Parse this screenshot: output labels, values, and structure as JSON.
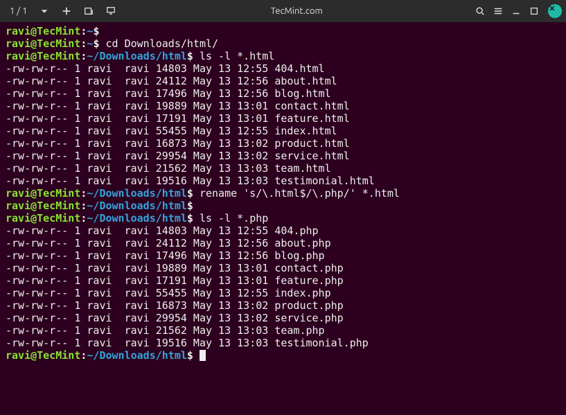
{
  "titlebar": {
    "tab_counter": "1 / 1",
    "title": "TecMint.com"
  },
  "prompts": [
    {
      "user": "ravi",
      "host": "TecMint",
      "path": "~",
      "command": ""
    },
    {
      "user": "ravi",
      "host": "TecMint",
      "path": "~",
      "command": "cd Downloads/html/"
    },
    {
      "user": "ravi",
      "host": "TecMint",
      "path": "~/Downloads/html",
      "command": "ls -l *.html"
    }
  ],
  "listing1": [
    {
      "perm": "-rw-rw-r--",
      "links": "1",
      "owner": "ravi",
      "group": "ravi",
      "size": "14803",
      "month": "May",
      "day": "13",
      "time": "12:55",
      "name": "404.html"
    },
    {
      "perm": "-rw-rw-r--",
      "links": "1",
      "owner": "ravi",
      "group": "ravi",
      "size": "24112",
      "month": "May",
      "day": "13",
      "time": "12:56",
      "name": "about.html"
    },
    {
      "perm": "-rw-rw-r--",
      "links": "1",
      "owner": "ravi",
      "group": "ravi",
      "size": "17496",
      "month": "May",
      "day": "13",
      "time": "12:56",
      "name": "blog.html"
    },
    {
      "perm": "-rw-rw-r--",
      "links": "1",
      "owner": "ravi",
      "group": "ravi",
      "size": "19889",
      "month": "May",
      "day": "13",
      "time": "13:01",
      "name": "contact.html"
    },
    {
      "perm": "-rw-rw-r--",
      "links": "1",
      "owner": "ravi",
      "group": "ravi",
      "size": "17191",
      "month": "May",
      "day": "13",
      "time": "13:01",
      "name": "feature.html"
    },
    {
      "perm": "-rw-rw-r--",
      "links": "1",
      "owner": "ravi",
      "group": "ravi",
      "size": "55455",
      "month": "May",
      "day": "13",
      "time": "12:55",
      "name": "index.html"
    },
    {
      "perm": "-rw-rw-r--",
      "links": "1",
      "owner": "ravi",
      "group": "ravi",
      "size": "16873",
      "month": "May",
      "day": "13",
      "time": "13:02",
      "name": "product.html"
    },
    {
      "perm": "-rw-rw-r--",
      "links": "1",
      "owner": "ravi",
      "group": "ravi",
      "size": "29954",
      "month": "May",
      "day": "13",
      "time": "13:02",
      "name": "service.html"
    },
    {
      "perm": "-rw-rw-r--",
      "links": "1",
      "owner": "ravi",
      "group": "ravi",
      "size": "21562",
      "month": "May",
      "day": "13",
      "time": "13:03",
      "name": "team.html"
    },
    {
      "perm": "-rw-rw-r--",
      "links": "1",
      "owner": "ravi",
      "group": "ravi",
      "size": "19516",
      "month": "May",
      "day": "13",
      "time": "13:03",
      "name": "testimonial.html"
    }
  ],
  "prompts2": [
    {
      "user": "ravi",
      "host": "TecMint",
      "path": "~/Downloads/html",
      "command": "rename 's/\\.html$/\\.php/' *.html"
    },
    {
      "user": "ravi",
      "host": "TecMint",
      "path": "~/Downloads/html",
      "command": ""
    },
    {
      "user": "ravi",
      "host": "TecMint",
      "path": "~/Downloads/html",
      "command": "ls -l *.php"
    }
  ],
  "listing2": [
    {
      "perm": "-rw-rw-r--",
      "links": "1",
      "owner": "ravi",
      "group": "ravi",
      "size": "14803",
      "month": "May",
      "day": "13",
      "time": "12:55",
      "name": "404.php"
    },
    {
      "perm": "-rw-rw-r--",
      "links": "1",
      "owner": "ravi",
      "group": "ravi",
      "size": "24112",
      "month": "May",
      "day": "13",
      "time": "12:56",
      "name": "about.php"
    },
    {
      "perm": "-rw-rw-r--",
      "links": "1",
      "owner": "ravi",
      "group": "ravi",
      "size": "17496",
      "month": "May",
      "day": "13",
      "time": "12:56",
      "name": "blog.php"
    },
    {
      "perm": "-rw-rw-r--",
      "links": "1",
      "owner": "ravi",
      "group": "ravi",
      "size": "19889",
      "month": "May",
      "day": "13",
      "time": "13:01",
      "name": "contact.php"
    },
    {
      "perm": "-rw-rw-r--",
      "links": "1",
      "owner": "ravi",
      "group": "ravi",
      "size": "17191",
      "month": "May",
      "day": "13",
      "time": "13:01",
      "name": "feature.php"
    },
    {
      "perm": "-rw-rw-r--",
      "links": "1",
      "owner": "ravi",
      "group": "ravi",
      "size": "55455",
      "month": "May",
      "day": "13",
      "time": "12:55",
      "name": "index.php"
    },
    {
      "perm": "-rw-rw-r--",
      "links": "1",
      "owner": "ravi",
      "group": "ravi",
      "size": "16873",
      "month": "May",
      "day": "13",
      "time": "13:02",
      "name": "product.php"
    },
    {
      "perm": "-rw-rw-r--",
      "links": "1",
      "owner": "ravi",
      "group": "ravi",
      "size": "29954",
      "month": "May",
      "day": "13",
      "time": "13:02",
      "name": "service.php"
    },
    {
      "perm": "-rw-rw-r--",
      "links": "1",
      "owner": "ravi",
      "group": "ravi",
      "size": "21562",
      "month": "May",
      "day": "13",
      "time": "13:03",
      "name": "team.php"
    },
    {
      "perm": "-rw-rw-r--",
      "links": "1",
      "owner": "ravi",
      "group": "ravi",
      "size": "19516",
      "month": "May",
      "day": "13",
      "time": "13:03",
      "name": "testimonial.php"
    }
  ],
  "prompts3": [
    {
      "user": "ravi",
      "host": "TecMint",
      "path": "~/Downloads/html",
      "command": ""
    }
  ]
}
